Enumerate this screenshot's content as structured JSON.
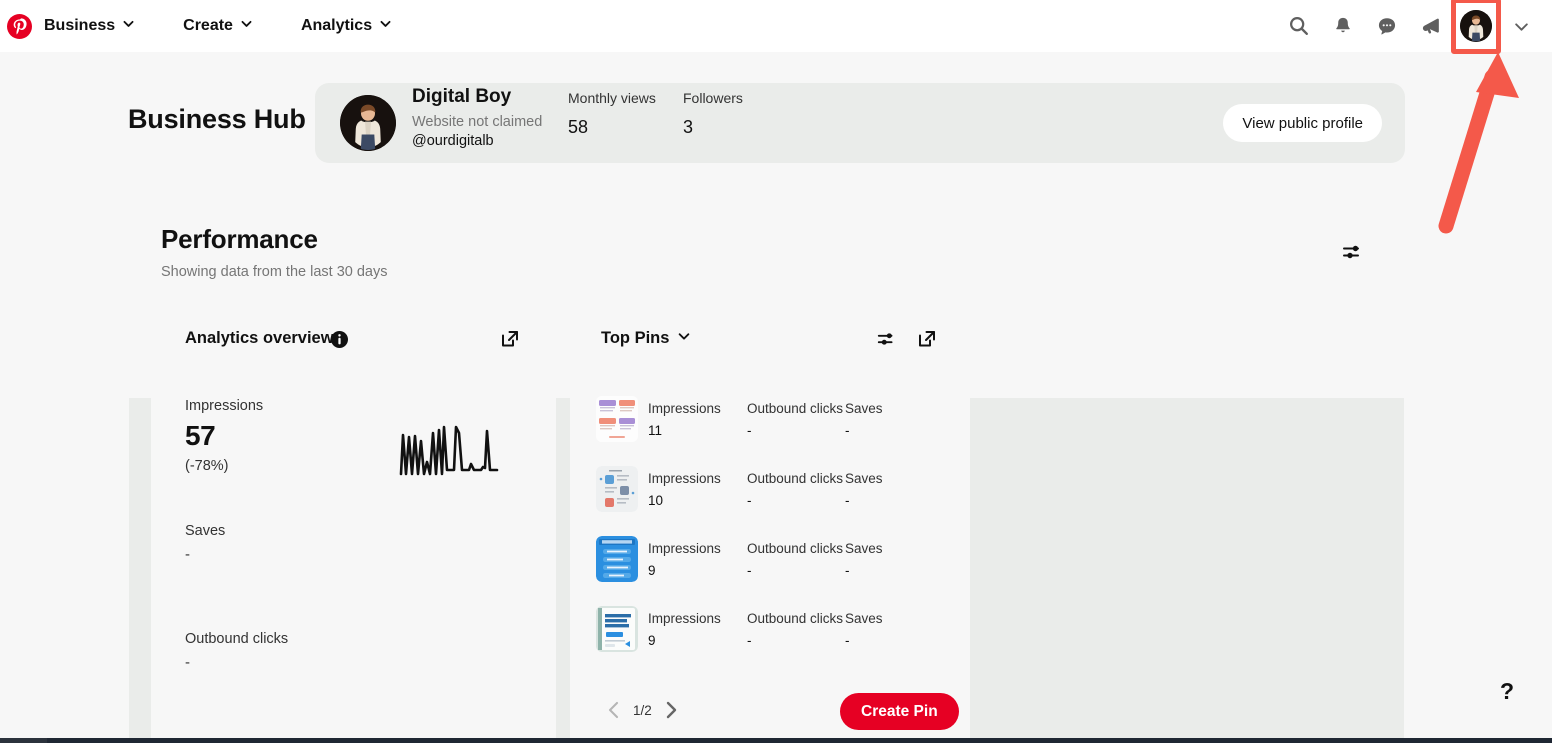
{
  "topnav": {
    "logo_icon": "pinterest-logo-icon",
    "items": [
      {
        "label": "Business",
        "icon": "chevron-down-icon"
      },
      {
        "label": "Create",
        "icon": "chevron-down-icon"
      },
      {
        "label": "Analytics",
        "icon": "chevron-down-icon"
      }
    ],
    "right_icons": [
      "search-icon",
      "bell-icon",
      "messages-icon",
      "megaphone-icon"
    ],
    "avatar_icon": "user-avatar",
    "account_chevron_icon": "chevron-down-icon"
  },
  "profile": {
    "hub_title": "Business Hub",
    "avatar_icon": "profile-avatar",
    "name": "Digital Boy",
    "website_status": "Website not claimed",
    "handle": "@ourdigitalb",
    "stats": [
      {
        "label": "Monthly views",
        "value": "58"
      },
      {
        "label": "Followers",
        "value": "3"
      }
    ],
    "view_public_profile": "View public profile"
  },
  "performance": {
    "title": "Performance",
    "subtitle": "Showing data from the last 30 days",
    "filter_icon": "sliders-icon"
  },
  "analytics_overview": {
    "title": "Analytics overview",
    "info_icon": "info-icon",
    "expand_icon": "external-link-icon",
    "metrics": [
      {
        "label": "Impressions",
        "value": "57",
        "delta": "(-78%)"
      },
      {
        "label": "Saves",
        "value": "-"
      },
      {
        "label": "Outbound clicks",
        "value": "-"
      }
    ]
  },
  "top_pins": {
    "title": "Top Pins",
    "title_chevron_icon": "chevron-down-icon",
    "filter_icon": "sliders-icon",
    "expand_icon": "external-link-icon",
    "columns": [
      "Impressions",
      "Outbound clicks",
      "Saves"
    ],
    "rows": [
      {
        "thumb_icon": "pin-thumbnail-quadrant-infographic",
        "impressions": "11",
        "outbound_clicks": "-",
        "saves": "-"
      },
      {
        "thumb_icon": "pin-thumbnail-diagram",
        "impressions": "10",
        "outbound_clicks": "-",
        "saves": "-"
      },
      {
        "thumb_icon": "pin-thumbnail-blue-list",
        "impressions": "9",
        "outbound_clicks": "-",
        "saves": "-"
      },
      {
        "thumb_icon": "pin-thumbnail-notebook",
        "impressions": "9",
        "outbound_clicks": "-",
        "saves": "-"
      }
    ],
    "pagination": {
      "prev_icon": "chevron-left-icon",
      "label": "1/2",
      "next_icon": "chevron-right-icon"
    },
    "create_pin": "Create Pin"
  },
  "help": {
    "label": "?"
  },
  "annotation": {
    "arrow_icon": "red-arrow-annotation",
    "highlight_icon": "red-highlight-box",
    "color": "#f4594a"
  },
  "colors": {
    "brand_red": "#e60023",
    "panel_gray": "#eaecea",
    "page_bg": "#f7f7f7",
    "annotation_red": "#f4594a"
  },
  "chart_data": {
    "type": "line",
    "title": "Impressions sparkline",
    "x": [
      1,
      2,
      3,
      4,
      5,
      6,
      7,
      8,
      9,
      10,
      11,
      12,
      13,
      14,
      15,
      16,
      17,
      18,
      19,
      20,
      21,
      22,
      23,
      24,
      25,
      26,
      27,
      28,
      29,
      30
    ],
    "values": [
      0,
      8,
      1,
      9,
      1,
      8,
      0,
      7,
      1,
      3,
      0,
      9,
      0,
      10,
      1,
      11,
      2,
      11,
      11,
      11,
      0,
      0,
      1,
      2,
      1,
      0,
      0,
      2,
      10,
      0
    ],
    "ylabel": "",
    "xlabel": "",
    "grid": false
  }
}
